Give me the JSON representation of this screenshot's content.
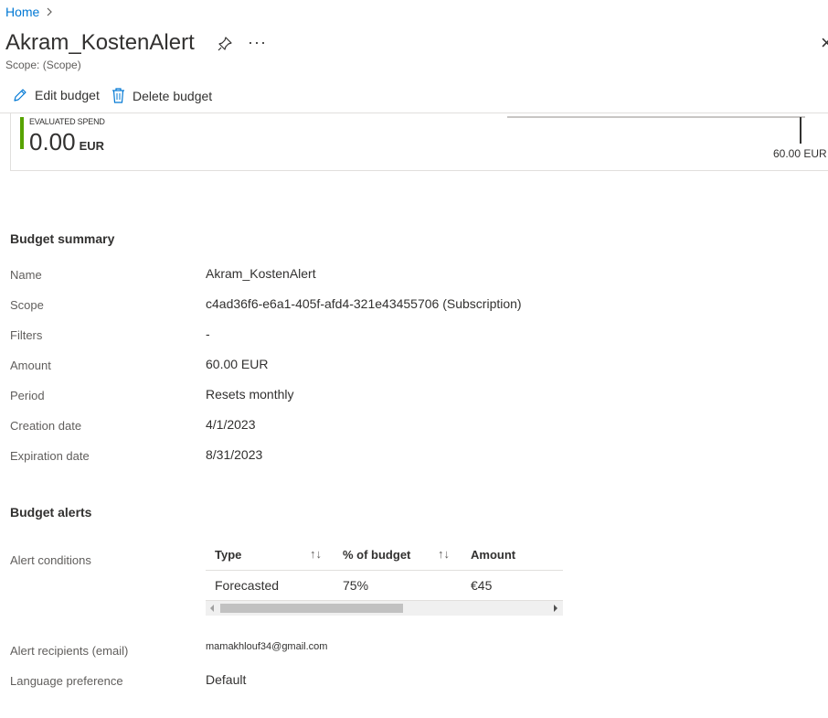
{
  "breadcrumb": {
    "home": "Home"
  },
  "header": {
    "title": "Akram_KostenAlert",
    "scope": "Scope: (Scope)",
    "more": "···",
    "close": "×"
  },
  "toolbar": {
    "edit_label": "Edit budget",
    "delete_label": "Delete budget"
  },
  "spend": {
    "label": "EVALUATED SPEND",
    "amount": "0.00",
    "currency": "EUR",
    "budget_marker": "60.00 EUR",
    "progress": 0,
    "accent_color": "#57a300"
  },
  "summary": {
    "title": "Budget summary",
    "rows": [
      {
        "label": "Name",
        "value": "Akram_KostenAlert"
      },
      {
        "label": "Scope",
        "value": "c4ad36f6-e6a1-405f-afd4-321e43455706 (Subscription)"
      },
      {
        "label": "Filters",
        "value": "-"
      },
      {
        "label": "Amount",
        "value": "60.00 EUR"
      },
      {
        "label": "Period",
        "value": "Resets monthly"
      },
      {
        "label": "Creation date",
        "value": "4/1/2023"
      },
      {
        "label": "Expiration date",
        "value": "8/31/2023"
      }
    ]
  },
  "alerts": {
    "title": "Budget alerts",
    "conditions_label": "Alert conditions",
    "columns": {
      "type": "Type",
      "percent": "% of budget",
      "amount": "Amount"
    },
    "sort_icon": "↑↓",
    "rows": [
      {
        "type": "Forecasted",
        "percent": "75%",
        "amount": "€45"
      }
    ],
    "recipients_label": "Alert recipients (email)",
    "recipients_value": "mamakhlouf34@gmail.com",
    "language_label": "Language preference",
    "language_value": "Default"
  }
}
